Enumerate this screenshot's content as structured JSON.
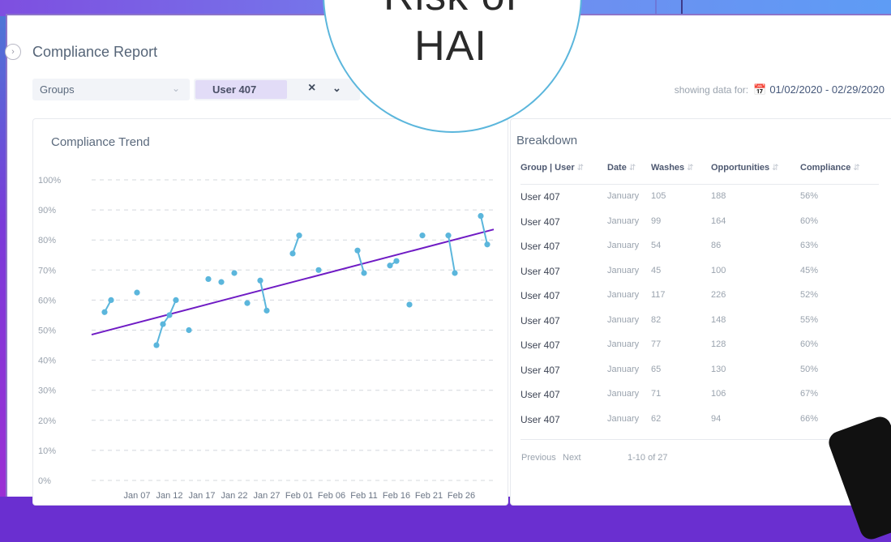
{
  "overlay": {
    "line1": "Risk of",
    "line2": "HAI"
  },
  "header": {
    "title": "Compliance Report"
  },
  "filters": {
    "groups_label": "Groups",
    "user_tag": "User 407",
    "showing_label": "showing data for:",
    "date_range": "01/02/2020 - 02/29/2020"
  },
  "trend": {
    "title": "Compliance Trend"
  },
  "chart_data": {
    "type": "scatter",
    "title": "Compliance Trend",
    "ylim": [
      0,
      100
    ],
    "y_ticks": [
      "0%",
      "10%",
      "20%",
      "30%",
      "40%",
      "50%",
      "60%",
      "70%",
      "80%",
      "90%",
      "100%"
    ],
    "x_ticks": [
      "Jan 07",
      "Jan 12",
      "Jan 17",
      "Jan 22",
      "Jan 27",
      "Feb 01",
      "Feb 06",
      "Feb 11",
      "Feb 16",
      "Feb 21",
      "Feb 26"
    ],
    "grid": true,
    "point_color": "#5bb6dc",
    "trend_color": "#6f1bc4",
    "points": [
      {
        "day": 2,
        "y": 56
      },
      {
        "day": 3,
        "y": 60
      },
      {
        "day": 7,
        "y": 62.5
      },
      {
        "day": 10,
        "y": 45
      },
      {
        "day": 11,
        "y": 52
      },
      {
        "day": 12,
        "y": 55
      },
      {
        "day": 13,
        "y": 60
      },
      {
        "day": 15,
        "y": 50
      },
      {
        "day": 18,
        "y": 67
      },
      {
        "day": 20,
        "y": 66
      },
      {
        "day": 22,
        "y": 69
      },
      {
        "day": 24,
        "y": 59
      },
      {
        "day": 26,
        "y": 66.5
      },
      {
        "day": 27,
        "y": 56.5
      },
      {
        "day": 31,
        "y": 75.5
      },
      {
        "day": 32,
        "y": 81.5
      },
      {
        "day": 35,
        "y": 70
      },
      {
        "day": 41,
        "y": 76.5
      },
      {
        "day": 42,
        "y": 69
      },
      {
        "day": 46,
        "y": 71.5
      },
      {
        "day": 47,
        "y": 73
      },
      {
        "day": 49,
        "y": 58.5
      },
      {
        "day": 51,
        "y": 81.5
      },
      {
        "day": 55,
        "y": 81.5
      },
      {
        "day": 56,
        "y": 69
      },
      {
        "day": 60,
        "y": 88
      },
      {
        "day": 61,
        "y": 78.5
      }
    ],
    "links": [
      [
        0,
        1
      ],
      [
        4,
        3
      ],
      [
        4,
        5
      ],
      [
        5,
        6
      ],
      [
        12,
        13
      ],
      [
        14,
        15
      ],
      [
        17,
        18
      ],
      [
        19,
        20
      ],
      [
        23,
        24
      ],
      [
        25,
        26
      ]
    ],
    "trend": {
      "y_start": 48.5,
      "y_end": 83.5
    }
  },
  "breakdown": {
    "title": "Breakdown",
    "columns": [
      "Group | User",
      "Date",
      "Washes",
      "Opportunities",
      "Compliance"
    ],
    "rows": [
      [
        "User 407",
        "January",
        "105",
        "188",
        "56%"
      ],
      [
        "User 407",
        "January",
        "99",
        "164",
        "60%"
      ],
      [
        "User 407",
        "January",
        "54",
        "86",
        "63%"
      ],
      [
        "User 407",
        "January",
        "45",
        "100",
        "45%"
      ],
      [
        "User 407",
        "January",
        "117",
        "226",
        "52%"
      ],
      [
        "User 407",
        "January",
        "82",
        "148",
        "55%"
      ],
      [
        "User 407",
        "January",
        "77",
        "128",
        "60%"
      ],
      [
        "User 407",
        "January",
        "65",
        "130",
        "50%"
      ],
      [
        "User 407",
        "January",
        "71",
        "106",
        "67%"
      ],
      [
        "User 407",
        "January",
        "62",
        "94",
        "66%"
      ]
    ],
    "previous_label": "Previous",
    "next_label": "Next",
    "range_label": "1-10 of 27"
  }
}
